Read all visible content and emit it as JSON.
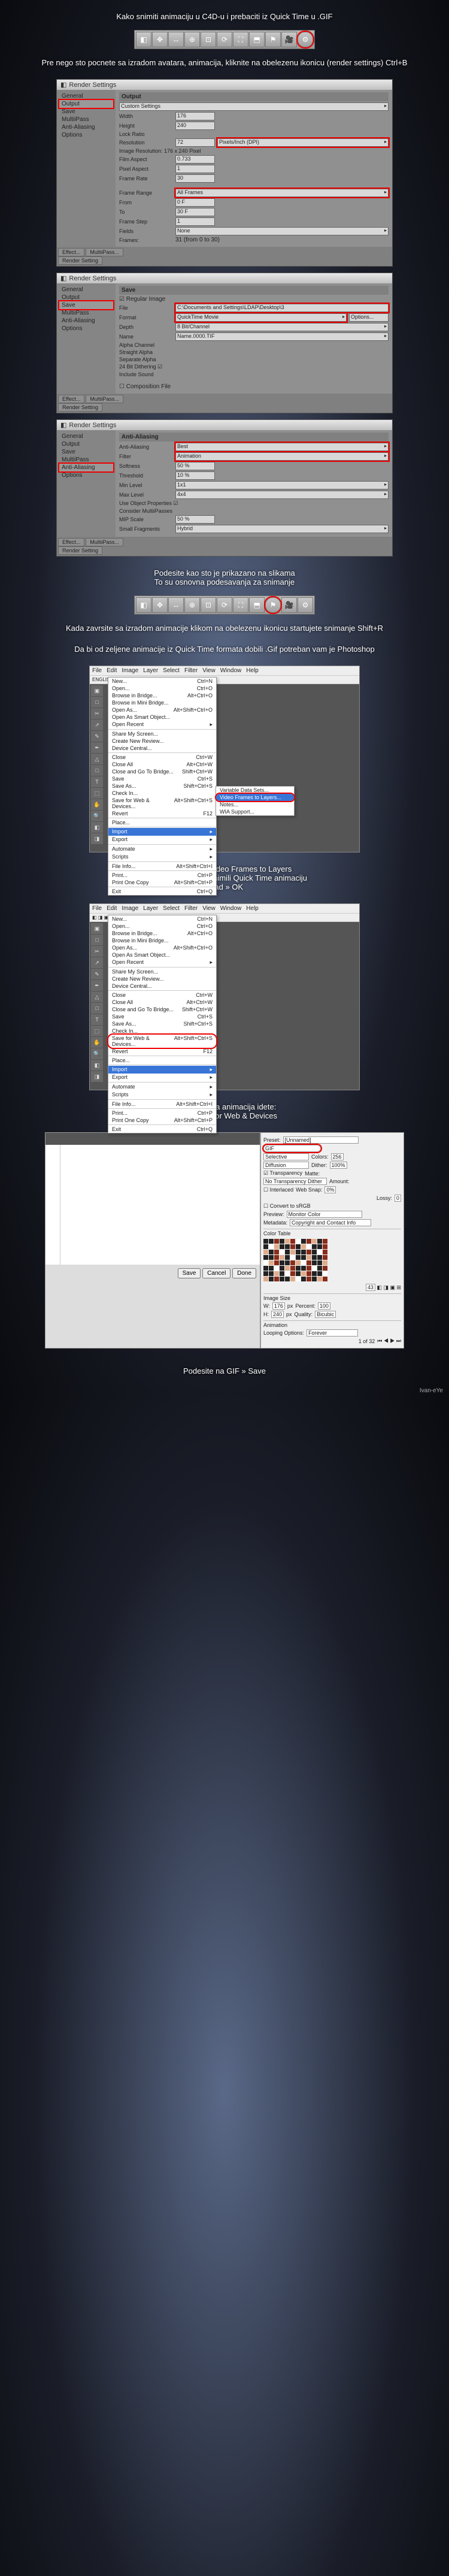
{
  "intro": {
    "line1": "Kako snimiti animaciju u C4D-u i prebaciti iz Quick Time u .GIF",
    "line2": "Pre nego sto pocnete sa izradom avatara, animacija, kliknite na obelezenu ikonicu (render settings) Ctrl+B"
  },
  "toolbar1_icons": [
    "◧",
    "✥",
    "↔",
    "⊕",
    "⊡",
    "⟳",
    "⛶",
    "⬒",
    "⚑",
    "🎥",
    "⚙"
  ],
  "panel1": {
    "title": "Render Settings",
    "sidebar": [
      "General",
      "Output",
      "Save",
      "MultiiPass",
      "Anti-Aliasing",
      "Options"
    ],
    "sel": "Output",
    "hdr": "Output",
    "preset": "Custom Settings",
    "fields": {
      "width": "Width",
      "width_v": "176",
      "height": "Height",
      "height_v": "240",
      "lock": "Lock Ratio",
      "res": "Resolution",
      "res_v": "72",
      "res_dd": "Pixels/Inch (DPI)",
      "img_res": "Image Resolution: 176 x 240 Pixel",
      "film_aspect": "Film Aspect",
      "film_aspect_v": "0.733",
      "pixel_aspect": "Pixel Aspect",
      "pixel_aspect_v": "1",
      "frame_rate": "Frame Rate",
      "frame_rate_v": "30",
      "frame_range": "Frame Range",
      "frame_range_v": "All Frames",
      "from": "From",
      "from_v": "0 F",
      "to": "To",
      "to_v": "30 F",
      "step": "Frame Step",
      "step_v": "1",
      "fields_l": "Fields",
      "fields_v": "None",
      "frames": "Frames:",
      "frames_v": "31 (from 0 to 30)"
    },
    "footer": [
      "Effect...",
      "MultiiPass..."
    ],
    "footer2": "Render Setting"
  },
  "panel2": {
    "title": "Render Settings",
    "sidebar": [
      "General",
      "Output",
      "Save",
      "MultiiPass",
      "Anti-Aliasing",
      "Options"
    ],
    "sel": "Save",
    "hdr": "Save",
    "reg_img": "☑ Regular Image",
    "fields": {
      "file": "File",
      "file_v": "C:\\Documents and Settings\\LDAP\\Desktop\\3",
      "format": "Format",
      "format_v": "QuickTime Movie",
      "opts": "Options...",
      "depth": "Depth",
      "depth_v": "8 Bit/Channel",
      "name": "Name",
      "name_v": "Name.0000.TIF",
      "alpha": "Alpha Channel",
      "straight": "Straight Alpha",
      "sep_alpha": "Separate Alpha",
      "dither": "24 Bit Dithering ☑",
      "sound": "Include Sound"
    },
    "comp": "☐ Composition File",
    "footer": [
      "Effect...",
      "MultiiPass..."
    ],
    "footer2": "Render Setting"
  },
  "panel3": {
    "title": "Render Settings",
    "sidebar": [
      "General",
      "Output",
      "Save",
      "MultiiPass",
      "Anti-Aliasing",
      "Options"
    ],
    "sel": "Anti-Aliasing",
    "hdr": "Anti-Aliasing",
    "fields": {
      "aa": "Anti-Aliasing",
      "aa_v": "Best",
      "filter": "Filter",
      "filter_v": "Animation",
      "softness": "Softness",
      "softness_v": "50 %",
      "thresh": "Threshold",
      "thresh_v": "10 %",
      "min": "Min Level",
      "min_v": "1x1",
      "max": "Max Level",
      "max_v": "4x4",
      "useobj": "Use Object Properties ☑",
      "mp": "Consider MultiiPasses",
      "mip": "MIP Scale",
      "mip_v": "50 %",
      "small": "Small Fragments",
      "small_v": "Hybrid"
    },
    "footer": [
      "Effect...",
      "MultiiPass..."
    ],
    "footer2": "Render Setting"
  },
  "mid1": "Podesite kao sto je prikazano na slikama\nTo su osnovna podesavanja za snimanje",
  "toolbar2_icons": [
    "◧",
    "✥",
    "↔",
    "⊕",
    "⊡",
    "⟳",
    "⛶",
    "⬒",
    "⚑",
    "🎥",
    "⚙"
  ],
  "mid2": "Kada zavrsite sa izradom animacije klikom na obelezenu ikonicu startujete snimanje Shift+R",
  "mid3": "Da bi od zeljene animacije iz Quick Time formata dobili .Gif potreban vam je Photoshop",
  "ps1": {
    "menubar": [
      "File",
      "Edit",
      "Image",
      "Layer",
      "Select",
      "Filter",
      "View",
      "Window",
      "Help"
    ],
    "extra_bar": "ENGLISH",
    "tools": [
      "▣",
      "□",
      "✂",
      "↗",
      "✎",
      "✒",
      "△",
      "□",
      "T",
      "⬚",
      "✋",
      "🔍",
      "◧",
      "◨"
    ],
    "menu": [
      {
        "l": "New...",
        "s": "Ctrl+N"
      },
      {
        "l": "Open...",
        "s": "Ctrl+O"
      },
      {
        "l": "Browse in Bridge...",
        "s": "Alt+Ctrl+O"
      },
      {
        "l": "Browse in Mini Bridge..."
      },
      {
        "l": "Open As...",
        "s": "Alt+Shift+Ctrl+O"
      },
      {
        "l": "Open As Smart Object..."
      },
      {
        "l": "Open Recent",
        "sub": true
      },
      {
        "sep": true
      },
      {
        "l": "Share My Screen..."
      },
      {
        "l": "Create New Review..."
      },
      {
        "l": "Device Central..."
      },
      {
        "sep": true
      },
      {
        "l": "Close",
        "s": "Ctrl+W"
      },
      {
        "l": "Close All",
        "s": "Alt+Ctrl+W"
      },
      {
        "l": "Close and Go To Bridge...",
        "s": "Shift+Ctrl+W"
      },
      {
        "l": "Save",
        "s": "Ctrl+S"
      },
      {
        "l": "Save As...",
        "s": "Shift+Ctrl+S"
      },
      {
        "l": "Check In..."
      },
      {
        "l": "Save for Web & Devices...",
        "s": "Alt+Shift+Ctrl+S"
      },
      {
        "l": "Revert",
        "s": "F12"
      },
      {
        "sep": true
      },
      {
        "l": "Place..."
      },
      {
        "sep": true
      },
      {
        "l": "Import",
        "sub": true,
        "hover": true
      },
      {
        "l": "Export",
        "sub": true
      },
      {
        "sep": true
      },
      {
        "l": "Automate",
        "sub": true
      },
      {
        "l": "Scripts",
        "sub": true
      },
      {
        "sep": true
      },
      {
        "l": "File Info...",
        "s": "Alt+Shift+Ctrl+I"
      },
      {
        "sep": true
      },
      {
        "l": "Print...",
        "s": "Ctrl+P"
      },
      {
        "l": "Print One Copy",
        "s": "Alt+Shift+Ctrl+P"
      },
      {
        "sep": true
      },
      {
        "l": "Exit",
        "s": "Ctrl+Q"
      }
    ],
    "submenu": [
      {
        "l": "Variable Data Sets..."
      },
      {
        "l": "Video Frames to Layers...",
        "hover": true,
        "hl": true
      },
      {
        "l": "Notes..."
      },
      {
        "l": "WIA Support..."
      }
    ]
  },
  "mid4": "File » Import » Video Frames to Layers\nPronadjete gde ste snimili Quick Time animaciju\nLoad » OK",
  "ps2_hl": "Save for Web & Devices...",
  "mid5": "Kada se ucita animacija idete:\nFile » Save for Web & Devices",
  "sfw": {
    "preset": "Preset:",
    "format": "GIF",
    "color_alg": "Selective",
    "colors_l": "Colors:",
    "colors_v": "256",
    "dither_alg": "Diffusion",
    "dither_l": "Dither:",
    "dither_v": "100%",
    "trans": "☑ Transparency",
    "matte_l": "Matte:",
    "notrans": "No Transparency Dither",
    "amount_l": "Amount:",
    "inter": "☐ Interlaced",
    "websnap_l": "Web Snap:",
    "websnap_v": "0%",
    "lossy_l": "Lossy:",
    "lossy_v": "0",
    "convert": "☐ Convert to sRGB",
    "preview": "Preview:",
    "preview_v": "Monitor Color",
    "meta": "Metadata:",
    "meta_v": "Copyright and Contact Info",
    "ct": "Color Table",
    "ct_count": "43",
    "imgsize": "Image Size",
    "w_l": "W:",
    "w_v": "176",
    "px": "px",
    "h_l": "H:",
    "h_v": "240",
    "pct_l": "Percent:",
    "pct_v": "100",
    "quality_l": "Quality:",
    "quality_v": "Bicubic",
    "anim": "Animation",
    "loop_l": "Looping Options:",
    "loop_v": "Forever",
    "frame_info": "1 of 32",
    "buttons": [
      "Save",
      "Cancel",
      "Done"
    ]
  },
  "final": "Podesite na GIF » Save",
  "credit": "Ivan-eYe"
}
